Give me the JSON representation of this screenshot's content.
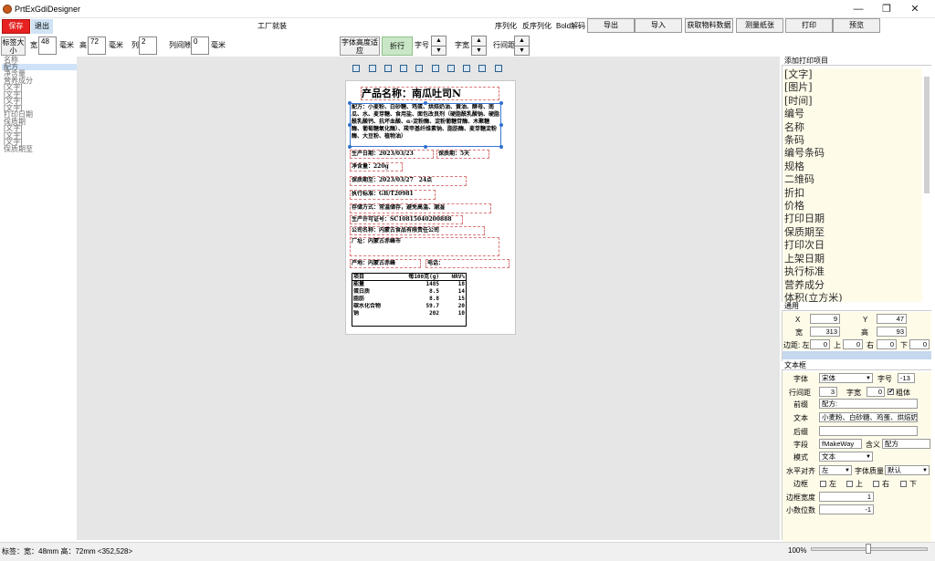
{
  "window": {
    "title": "PrtExGdiDesigner",
    "minimize": "—",
    "maximize": "❐",
    "close": "✕"
  },
  "toolbar": {
    "save": "保存",
    "exit": "退出",
    "factory": "工厂就装",
    "serialize": "序列化",
    "deserialize": "反序列化",
    "bold_decode": "Bold解码",
    "export": "导出",
    "import": "导入",
    "fetch_material": "获取物料数据",
    "measure_paper": "测量纸张",
    "print": "打印",
    "preview": "预览"
  },
  "sizebar": {
    "label_size": "标签大小",
    "width_label": "宽",
    "width_value": "48",
    "mm1": "毫米",
    "height_label": "高",
    "height_value": "72",
    "mm2": "毫米",
    "cols_label": "列",
    "cols_value": "2",
    "colgap_label": "列间隙",
    "colgap_value": "0",
    "mm3": "毫米",
    "font_adapt": "字体高度适应",
    "wrap": "折行",
    "font_size": "字号",
    "font_width": "字宽",
    "line_spacing": "行间距"
  },
  "left_list": {
    "items": [
      {
        "text": "名称"
      },
      {
        "text": "配方"
      },
      {
        "text": "净含量"
      },
      {
        "text": "营养成分"
      },
      {
        "text": "[文字]"
      },
      {
        "text": "[文字]"
      },
      {
        "text": "[文字]"
      },
      {
        "text": "[文字]"
      },
      {
        "text": "打印日期"
      },
      {
        "text": "保质期"
      },
      {
        "text": "[文字]"
      },
      {
        "text": "[文字]"
      },
      {
        "text": "[文字]"
      },
      {
        "text": "保质期至"
      }
    ],
    "selected_index": 1
  },
  "label": {
    "product_name": "产品名称：南瓜吐司N",
    "recipe": "配方：小麦粉、白砂糖、鸡蛋、烘焙奶油、黄油、酵母、南瓜、水、麦芽糖、食用盐、面包改良剂（硬脂酰乳酸钠、硬脂酰乳酸钙、抗坏血酸、α-淀粉酶、淀粉葡糖苷酶、木聚糖酶、葡萄糖氧化酶）、羧甲基纤维素钠、脂肪酶、麦芽糖淀粉酶、大豆粉、植物油）",
    "production_date": "生产日期：2023/03/23",
    "shelf_life": "保质期：5天",
    "net_content": "净含量：220g",
    "expiry": "保质期至：2023/03/27　24点",
    "standard": "执行标准：GB/T20981",
    "storage": "存储方式：常温储存，避免高温、潮湿",
    "license": "生产许可证号：SC10815040200888",
    "company": "公司名称：内蒙古食品有限责任公司",
    "address": "厂址：内蒙古赤峰市",
    "origin": "产地：内蒙古赤峰",
    "phone": "电话："
  },
  "chart_data": {
    "type": "table",
    "columns": [
      "项目",
      "每100克(g)",
      "NRV%"
    ],
    "rows": [
      [
        "能量",
        "1485",
        "18"
      ],
      [
        "蛋白质",
        "8.5",
        "14"
      ],
      [
        "脂肪",
        "8.8",
        "15"
      ],
      [
        "碳水化合物",
        "59.7",
        "20"
      ],
      [
        "钠",
        "202",
        "10"
      ]
    ]
  },
  "panel_items": {
    "title": "添加打印项目",
    "items": [
      "[文字]",
      "[图片]",
      "[时间]",
      "编号",
      "名称",
      "条码",
      "编号条码",
      "规格",
      "二维码",
      "折扣",
      "价格",
      "打印日期",
      "保质期至",
      "打印次日",
      "上架日期",
      "执行标准",
      "营养成分",
      "体积(立方米)"
    ]
  },
  "general": {
    "title": "通用",
    "x_label": "X",
    "x_value": "9",
    "y_label": "Y",
    "y_value": "47",
    "w_label": "宽",
    "w_value": "313",
    "h_label": "高",
    "h_value": "93",
    "margin_label": "边距: 左",
    "m_left": "0",
    "m_top_label": "上",
    "m_top": "0",
    "m_right_label": "右",
    "m_right": "0",
    "m_bottom_label": "下",
    "m_bottom": "0"
  },
  "textbox": {
    "title": "文本框",
    "font_label": "字体",
    "font_value": "宋体",
    "size_label": "字号",
    "size_value": "-13",
    "linegap_label": "行间距",
    "linegap_value": "3",
    "charwidth_label": "字宽",
    "charwidth_value": "0",
    "bold_label": "粗体",
    "bold_checked": "✔",
    "prefix_label": "前缀",
    "prefix_value": "配方:",
    "text_label": "文本",
    "text_value": "小麦粉、白砂糖、鸡蛋、烘焙奶油",
    "suffix_label": "后缀",
    "suffix_value": "",
    "field_label": "字段",
    "field_value": "fMakeWay",
    "meaning_label": "含义",
    "meaning_value": "配方",
    "mode_label": "模式",
    "mode_value": "文本",
    "halign_label": "水平对齐",
    "halign_value": "左",
    "quality_label": "字体质量",
    "quality_value": "默认",
    "border_label": "边框",
    "b_left": "左",
    "b_top": "上",
    "b_right": "右",
    "b_bottom": "下",
    "borderwidth_label": "边框宽度",
    "borderwidth_value": "1",
    "decimals_label": "小数位数",
    "decimals_value": "-1"
  },
  "status": {
    "text": "标签：宽：48mm 高：72mm  <352,528>",
    "zoom": "100%"
  }
}
